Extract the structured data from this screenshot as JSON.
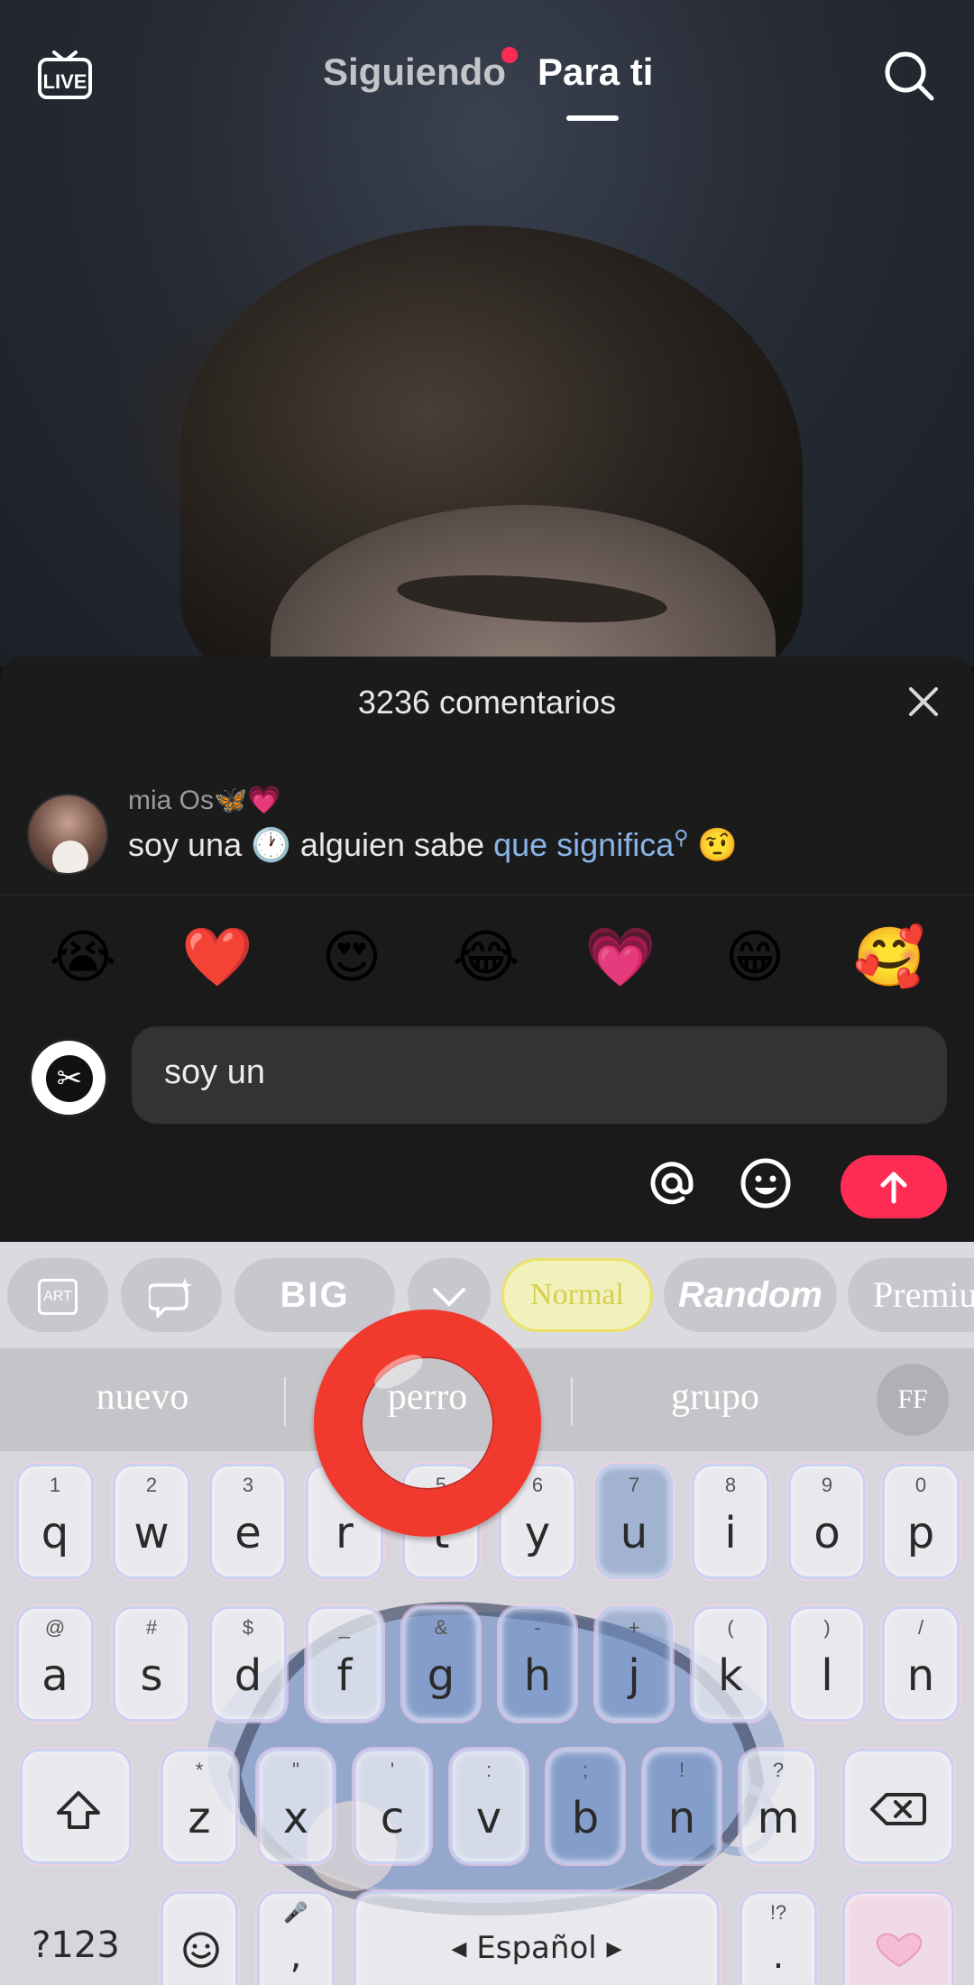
{
  "top_nav": {
    "live_label": "LIVE",
    "following_label": "Siguiendo",
    "for_you_label": "Para ti"
  },
  "comments": {
    "header": "3236 comentarios",
    "items": [
      {
        "user": "mia Os🦋💗",
        "text_before": "soy una 🕐 alguien sabe ",
        "link": "que significa",
        "text_after": " 🤨"
      }
    ]
  },
  "quick_emojis": [
    "😭",
    "❤️",
    "😍",
    "😂",
    "💗",
    "😁",
    "🥰"
  ],
  "composer": {
    "avatar_text": "✂",
    "input_value": "soy un"
  },
  "keyboard": {
    "font_styles": [
      "ART",
      "BIG",
      "Normal",
      "Random",
      "Premium"
    ],
    "suggestions": [
      "nuevo",
      "perro",
      "grupo"
    ],
    "font_toggle": "FF",
    "row1": [
      {
        "k": "q",
        "h": "1"
      },
      {
        "k": "w",
        "h": "2"
      },
      {
        "k": "e",
        "h": "3"
      },
      {
        "k": "r",
        "h": "4"
      },
      {
        "k": "t",
        "h": "5"
      },
      {
        "k": "y",
        "h": "6"
      },
      {
        "k": "u",
        "h": "7"
      },
      {
        "k": "i",
        "h": "8"
      },
      {
        "k": "o",
        "h": "9"
      },
      {
        "k": "p",
        "h": "0"
      }
    ],
    "row2": [
      {
        "k": "a",
        "h": "@"
      },
      {
        "k": "s",
        "h": "#"
      },
      {
        "k": "d",
        "h": "$"
      },
      {
        "k": "f",
        "h": "_"
      },
      {
        "k": "g",
        "h": "&"
      },
      {
        "k": "h",
        "h": "-"
      },
      {
        "k": "j",
        "h": "+"
      },
      {
        "k": "k",
        "h": "("
      },
      {
        "k": "l",
        "h": ")"
      },
      {
        "k": "n",
        "h": "/"
      }
    ],
    "row3": [
      {
        "k": "z",
        "h": "*"
      },
      {
        "k": "x",
        "h": "\""
      },
      {
        "k": "c",
        "h": "'"
      },
      {
        "k": "v",
        "h": ":"
      },
      {
        "k": "b",
        "h": ";"
      },
      {
        "k": "n",
        "h": "!"
      },
      {
        "k": "m",
        "h": "?"
      }
    ],
    "symbols_label": "?123",
    "comma_label": ",",
    "space_label": "Español",
    "period_label": ".",
    "period_hint": "!?"
  },
  "colors": {
    "accent": "#fe2c55",
    "link": "#8ab4e8",
    "overlay_circle": "#f2392e"
  }
}
